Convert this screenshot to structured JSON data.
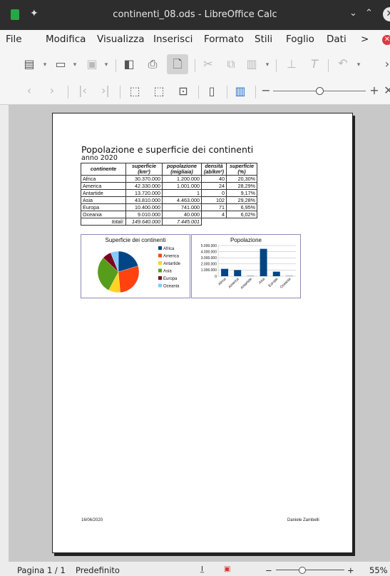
{
  "window": {
    "title": "continenti_08.ods - LibreOffice Calc"
  },
  "menu": [
    "File",
    "Modifica",
    "Visualizza",
    "Inserisci",
    "Formato",
    "Stili",
    "Foglio",
    "Dati"
  ],
  "menu_more": ">",
  "document": {
    "title": "Popolazione e superficie dei continenti",
    "subtitle": "anno 2020",
    "headers": [
      {
        "l1": "",
        "l2": "continente"
      },
      {
        "l1": "superficie",
        "l2": "(km²)"
      },
      {
        "l1": "popolazione",
        "l2": "(migliaia)"
      },
      {
        "l1": "densità",
        "l2": "(ab/km²)"
      },
      {
        "l1": "superficie",
        "l2": "(%)"
      }
    ],
    "rows": [
      [
        "Africa",
        "30.370.000",
        "1.200.000",
        "40",
        "20,30%"
      ],
      [
        "America",
        "42.330.000",
        "1.001.000",
        "24",
        "28,29%"
      ],
      [
        "Antartide",
        "13.720.000",
        "1",
        "0",
        "9,17%"
      ],
      [
        "Asia",
        "43.810.000",
        "4.463.000",
        "102",
        "29,28%"
      ],
      [
        "Europa",
        "10.400.000",
        "741.000",
        "71",
        "6,95%"
      ],
      [
        "Oceania",
        "9.010.000",
        "40.000",
        "4",
        "6,02%"
      ]
    ],
    "total": [
      "totali:",
      "149.640.000",
      "7.445.001"
    ],
    "footer_date": "16/06/2020",
    "footer_author": "Daniele Zambelli"
  },
  "chart_data": [
    {
      "type": "pie",
      "title": "Superficie dei continenti",
      "categories": [
        "Africa",
        "America",
        "Antartide",
        "Asia",
        "Europa",
        "Oceania"
      ],
      "values": [
        30370000,
        42330000,
        13720000,
        43810000,
        10400000,
        9010000
      ],
      "colors": [
        "#004586",
        "#ff420e",
        "#ffd320",
        "#579d1c",
        "#7e0021",
        "#83caff"
      ],
      "legend": "right"
    },
    {
      "type": "bar",
      "title": "Popolazione",
      "categories": [
        "Africa",
        "America",
        "Antartide",
        "Asia",
        "Europa",
        "Oceania"
      ],
      "values": [
        1200000,
        1001000,
        1,
        4463000,
        741000,
        40000
      ],
      "ylim": [
        0,
        5000000
      ],
      "yticks": [
        "0",
        "1.000.000",
        "2.000.000",
        "3.000.000",
        "4.000.000",
        "5.000.000"
      ],
      "color": "#004586",
      "grid": true
    }
  ],
  "statusbar": {
    "page": "Pagina 1 / 1",
    "style": "Predefinito",
    "zoom": "55%"
  },
  "colors": {
    "titlebar": "#2d2d2d",
    "accent_green": "#28a745"
  }
}
